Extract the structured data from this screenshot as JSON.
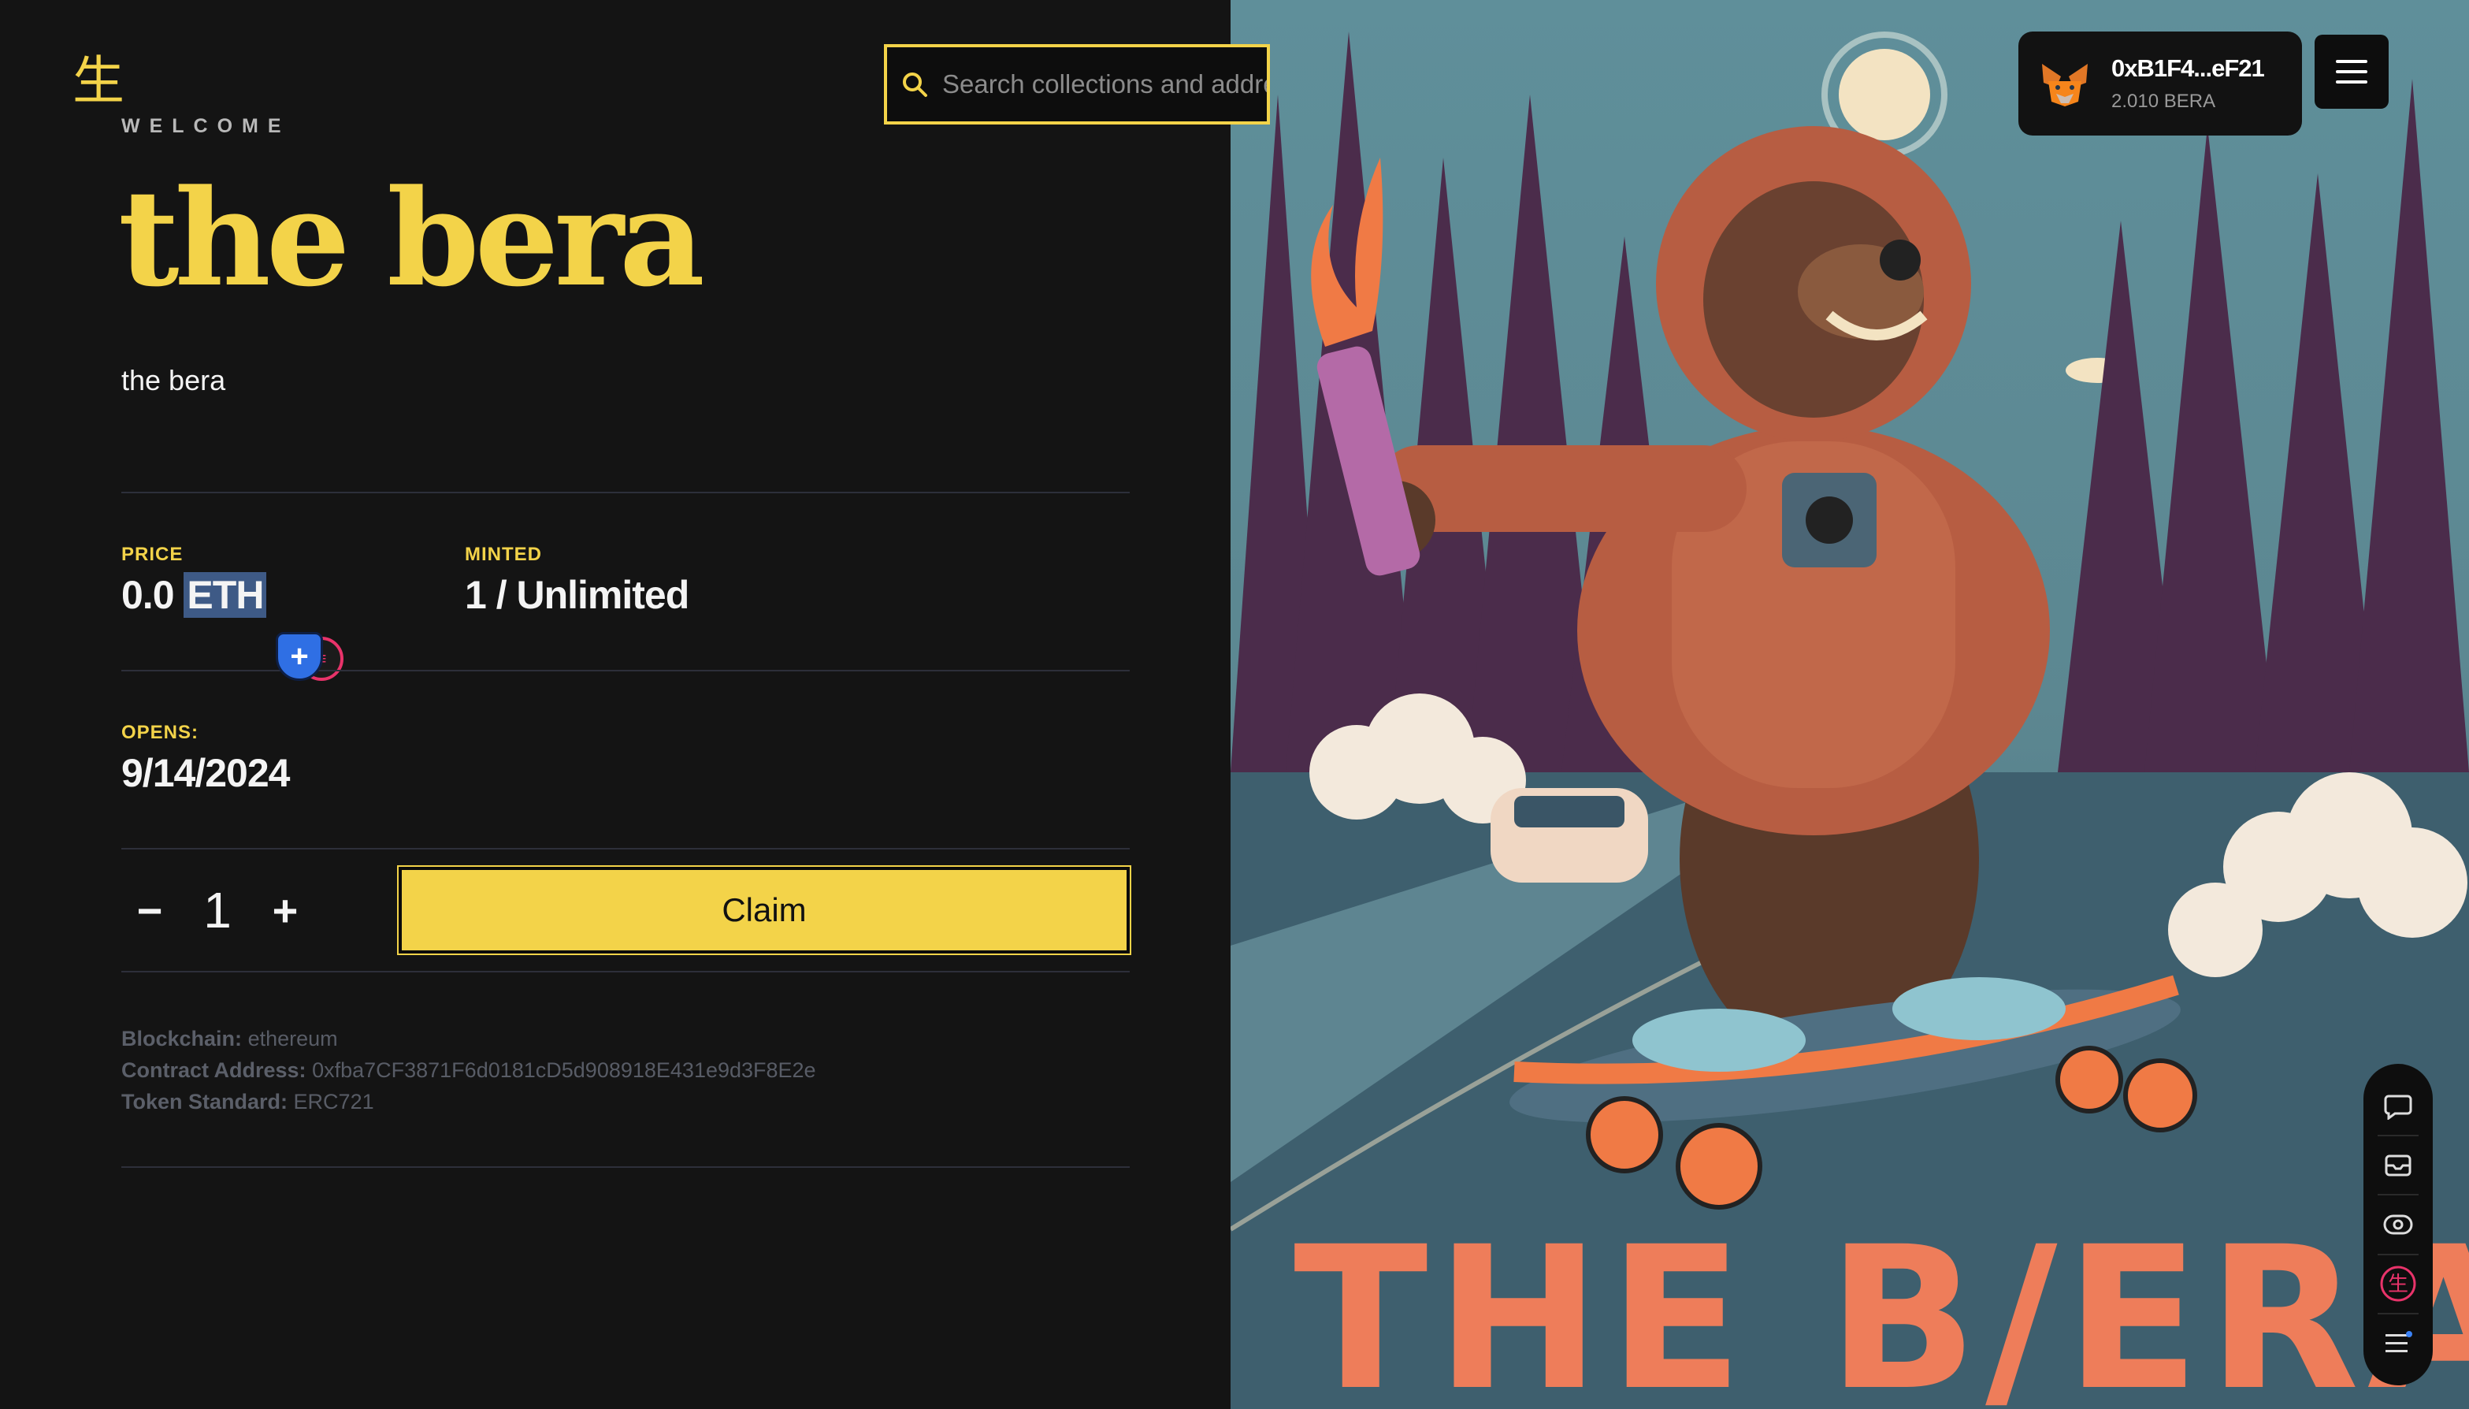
{
  "brand": {
    "logo_glyph": "生",
    "accent": "#f3d349"
  },
  "header": {
    "welcome": "WELCOME"
  },
  "collection": {
    "title": "the bera",
    "description": "the bera"
  },
  "stats": {
    "price_label": "PRICE",
    "price_amount": "0.0",
    "price_unit": "ETH",
    "minted_label": "MINTED",
    "minted_value": "1 / Unlimited",
    "opens_label": "OPENS:",
    "opens_value": "9/14/2024"
  },
  "mint": {
    "decrement": "−",
    "quantity": "1",
    "increment": "+",
    "claim_label": "Claim"
  },
  "meta": {
    "blockchain_label": "Blockchain:",
    "blockchain_value": "ethereum",
    "contract_label": "Contract Address:",
    "contract_value": "0xfba7CF3871F6d0181cD5d908918E431e9d3F8E2e",
    "standard_label": "Token Standard:",
    "standard_value": "ERC721"
  },
  "search": {
    "placeholder": "Search collections and addresses"
  },
  "wallet": {
    "address": "0xB1F4...eF21",
    "balance": "2.010 BERA",
    "icon": "metamask-fox-icon"
  },
  "artwork": {
    "caption": "THE B/ERA"
  },
  "dock": {
    "icons": [
      "chat-icon",
      "inbox-icon",
      "eye-icon",
      "logo-icon",
      "menu-icon"
    ]
  }
}
